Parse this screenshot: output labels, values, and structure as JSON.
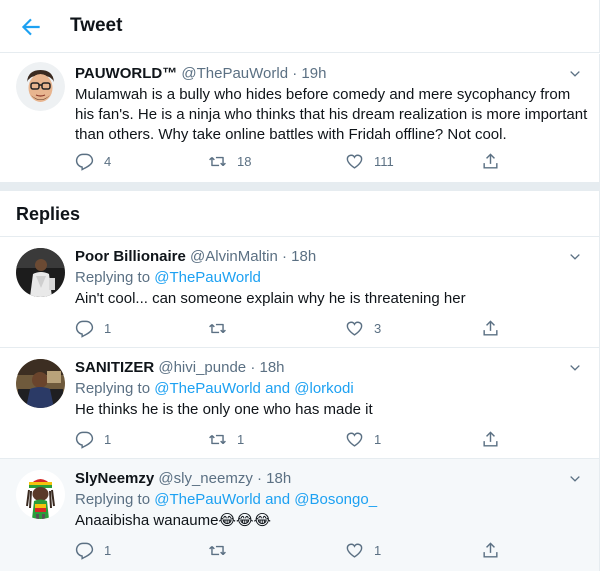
{
  "header": {
    "title": "Tweet",
    "back_icon": "back-arrow-icon",
    "accent": "#1da1f2"
  },
  "main_tweet": {
    "name": "PAUWORLD™",
    "handle": "@ThePauWorld",
    "time": "19h",
    "text": "Mulamwah is a bully who hides before comedy and mere sycophancy from his fan's. He is a ninja who thinks that his dream realization is more important than others. Why take online battles with Fridah offline? Not cool.",
    "replies": "4",
    "retweets": "18",
    "likes": "111"
  },
  "replies_section": {
    "title": "Replies"
  },
  "replies": [
    {
      "name": "Poor Billionaire",
      "handle": "@AlvinMaltin",
      "time": "18h",
      "replying_prefix": "Replying to",
      "replying_to": "@ThePauWorld",
      "replying_and": "",
      "replying_to_2": "",
      "text": "Ain't cool... can someone explain why he is threatening her",
      "replies": "1",
      "retweets": "",
      "likes": "3"
    },
    {
      "name": "SANITIZER",
      "handle": "@hivi_punde",
      "time": "18h",
      "replying_prefix": "Replying to",
      "replying_to": "@ThePauWorld",
      "replying_and": "and",
      "replying_to_2": "@lorkodi",
      "text": "He thinks he is the only one who has made it",
      "replies": "1",
      "retweets": "1",
      "likes": "1"
    },
    {
      "name": "SlyNeemzy",
      "handle": "@sly_neemzy",
      "time": "18h",
      "replying_prefix": "Replying to",
      "replying_to": "@ThePauWorld",
      "replying_and": "and",
      "replying_to_2": "@Bosongo_",
      "text": "Anaaibisha wanaume😂😂😂",
      "replies": "1",
      "retweets": "",
      "likes": "1"
    }
  ]
}
